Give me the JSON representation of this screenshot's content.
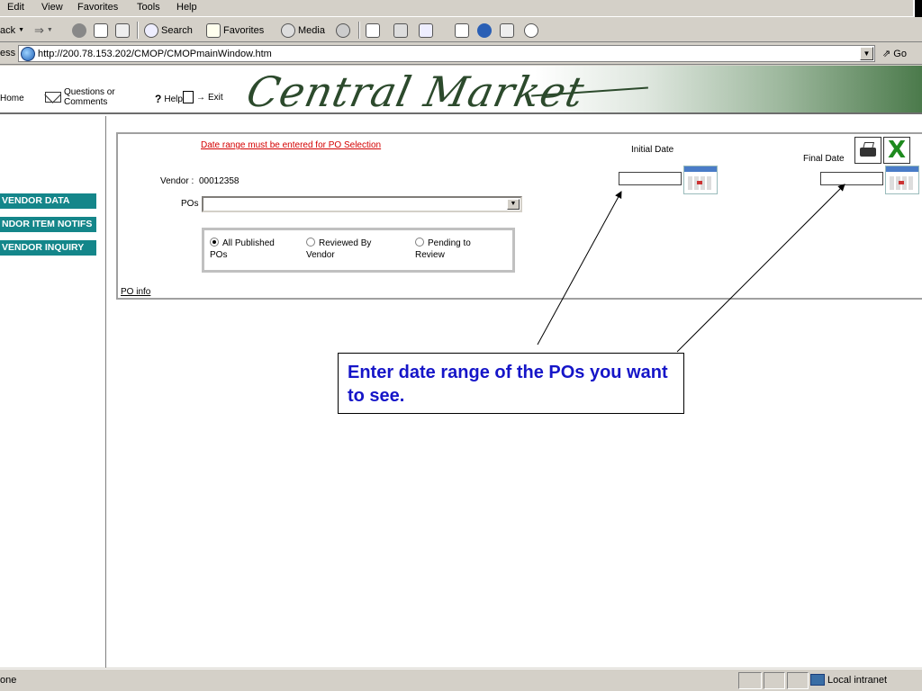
{
  "menu": [
    "Edit",
    "View",
    "Favorites",
    "Tools",
    "Help"
  ],
  "toolbar": {
    "back_label": "ack",
    "search_label": "Search",
    "favorites_label": "Favorites",
    "media_label": "Media"
  },
  "address": {
    "label": "ess",
    "url": "http://200.78.153.202/CMOP/CMOPmainWindow.htm",
    "go_label": "Go"
  },
  "header": {
    "home_label": "Home",
    "questions_line1": "Questions or",
    "questions_line2": "Comments",
    "help_label": "Help",
    "exit_label": "Exit",
    "logo_text": "Central Market"
  },
  "leftnav": {
    "items": [
      "VENDOR DATA",
      "NDOR ITEM NOTIFS",
      "VENDOR INQUIRY"
    ]
  },
  "form": {
    "warning": "Date range must be entered for PO Selection",
    "vendor_label": "Vendor :",
    "vendor_value": "00012358",
    "pos_label": "POs",
    "pos_value": "",
    "initial_date_label": "Initial Date",
    "initial_date_value": "",
    "final_date_label": "Final Date",
    "final_date_value": "",
    "radios": [
      {
        "line1": "All Published",
        "line2": "POs",
        "checked": true
      },
      {
        "line1": "Reviewed By",
        "line2": "Vendor",
        "checked": false
      },
      {
        "line1": "Pending to",
        "line2": "Review",
        "checked": false
      }
    ],
    "po_info_link": "PO info"
  },
  "callout": {
    "text": "Enter date range of the POs you want to see."
  },
  "status": {
    "text": "one",
    "zone": "Local intranet"
  },
  "colors": {
    "nav_teal": "#14868a",
    "warning_red": "#d40000",
    "callout_blue": "#1515c8"
  }
}
